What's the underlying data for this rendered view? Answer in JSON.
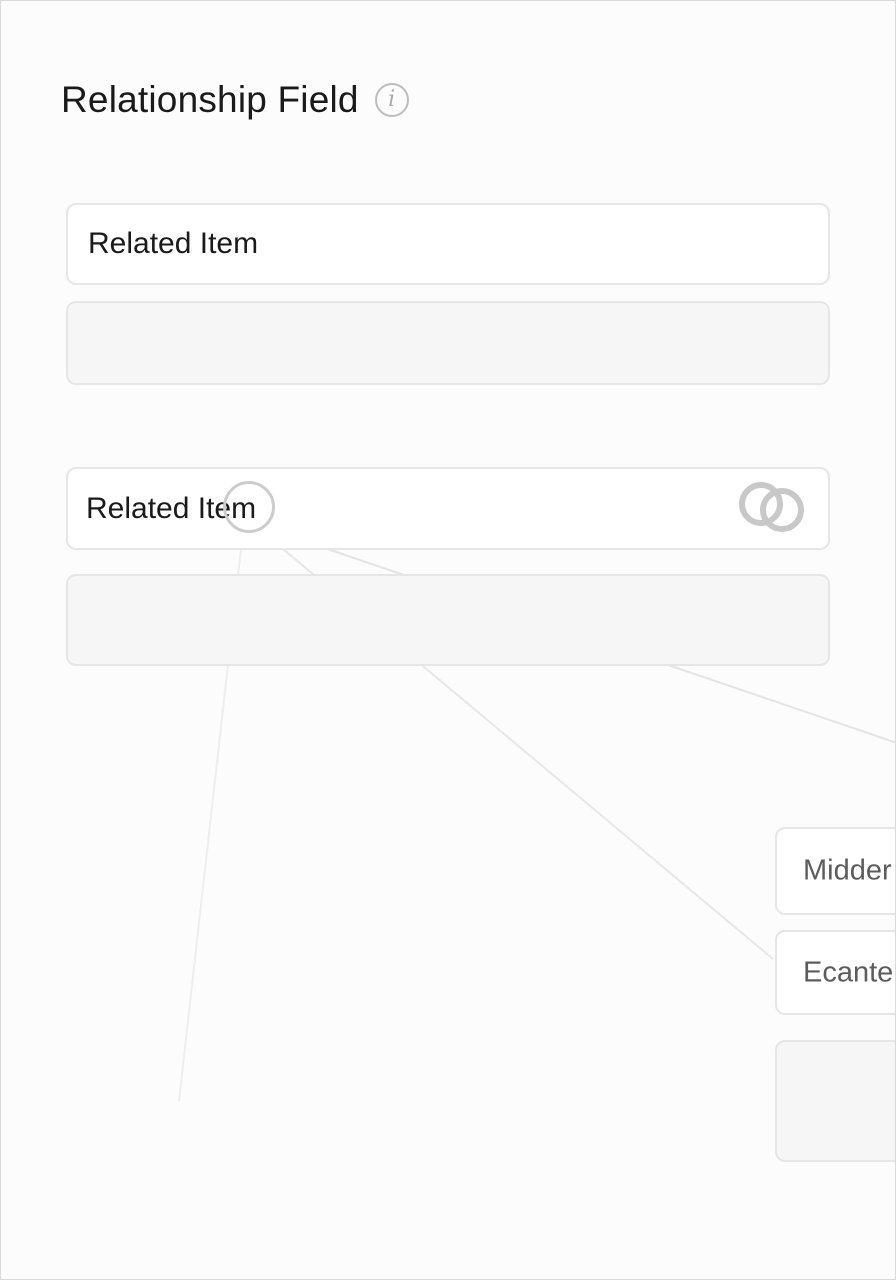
{
  "header": {
    "title": "Relationship Field",
    "info_icon": "info-icon"
  },
  "fields": {
    "first_label": "Related Item",
    "second_label": "Related Item"
  },
  "right_panel": {
    "items": [
      {
        "label": "Midder"
      },
      {
        "label": "Ecante"
      }
    ]
  },
  "icons": {
    "link": "link-icon",
    "anchor": "connector-anchor-icon",
    "arrow": "arrow-right-icon"
  },
  "colors": {
    "text": "#1a1a1a",
    "muted_text": "#5c5c5c",
    "border": "#e6e6e6",
    "connector": "#8a8a8a"
  }
}
